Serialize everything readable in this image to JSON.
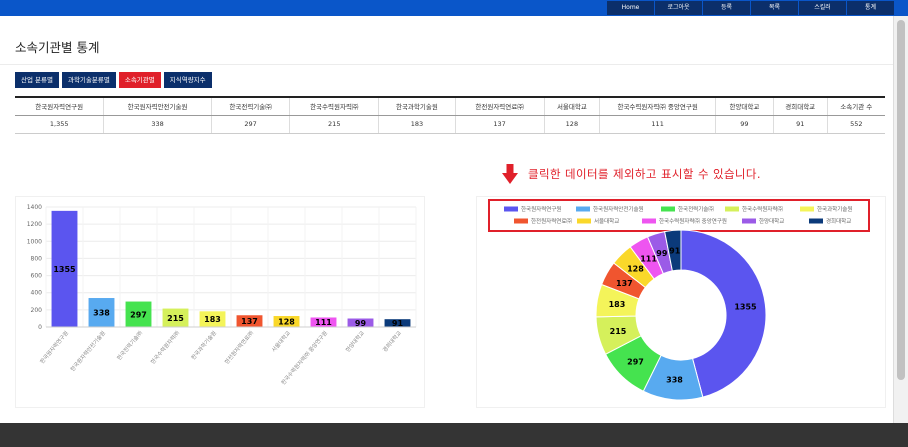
{
  "nav": {
    "items": [
      "Home",
      "로그아웃",
      "등록",
      "목록",
      "스킬러",
      "통계"
    ]
  },
  "page": {
    "title": "소속기관별 통계"
  },
  "tabs": [
    {
      "label": "산업 분류별",
      "active": false
    },
    {
      "label": "과학기술분류별",
      "active": false
    },
    {
      "label": "소속기관별",
      "active": true
    },
    {
      "label": "지식역량지수",
      "active": false
    }
  ],
  "table": {
    "headers": [
      "한국원자력연구원",
      "한국원자력안전기술원",
      "한국전력기술㈜",
      "한국수력원자력㈜",
      "한국과학기술원",
      "한전원자력연료㈜",
      "서울대학교",
      "한국수력원자력㈜ 중앙연구원",
      "한양대학교",
      "경희대학교",
      "소속기관 수"
    ],
    "values": [
      "1,355",
      "338",
      "297",
      "215",
      "183",
      "137",
      "128",
      "111",
      "99",
      "91",
      "552"
    ]
  },
  "hint": {
    "text": "클릭한 데이터를 제외하고 표시할 수 있습니다."
  },
  "chart_data": [
    {
      "type": "bar",
      "categories": [
        "한국원자력연구원",
        "한국원자력안전기술원",
        "한국전력기술㈜",
        "한국수력원자력㈜",
        "한국과학기술원",
        "한전원자력연료㈜",
        "서울대학교",
        "한국수력원자력㈜ 중앙연구원",
        "한양대학교",
        "경희대학교"
      ],
      "values": [
        1355,
        338,
        297,
        215,
        183,
        137,
        128,
        111,
        99,
        91
      ],
      "colors": [
        "#5b55ef",
        "#58aaf0",
        "#45e34f",
        "#d5f05b",
        "#f4f45a",
        "#f0552f",
        "#fad82a",
        "#ee55f0",
        "#9b5be7",
        "#0b3a7a"
      ],
      "yticks": [
        0,
        200,
        400,
        600,
        800,
        1000,
        1200,
        1400
      ],
      "ylim": [
        0,
        1400
      ],
      "grid": true
    },
    {
      "type": "pie",
      "labels": [
        "한국원자력연구원",
        "한국원자력안전기술원",
        "한국전력기술㈜",
        "한국수력원자력㈜",
        "한국과학기술원",
        "한전원자력연료㈜",
        "서울대학교",
        "한국수력원자력㈜ 중앙연구원",
        "한양대학교",
        "경희대학교"
      ],
      "values": [
        1355,
        338,
        297,
        215,
        183,
        137,
        128,
        111,
        99,
        91
      ],
      "colors": [
        "#5b55ef",
        "#58aaf0",
        "#45e34f",
        "#d5f05b",
        "#f4f45a",
        "#f0552f",
        "#fad82a",
        "#ee55f0",
        "#9b5be7",
        "#0b3a7a"
      ],
      "donut": true,
      "legend_position": "top",
      "legend_highlight_color": "#e0202a"
    }
  ]
}
